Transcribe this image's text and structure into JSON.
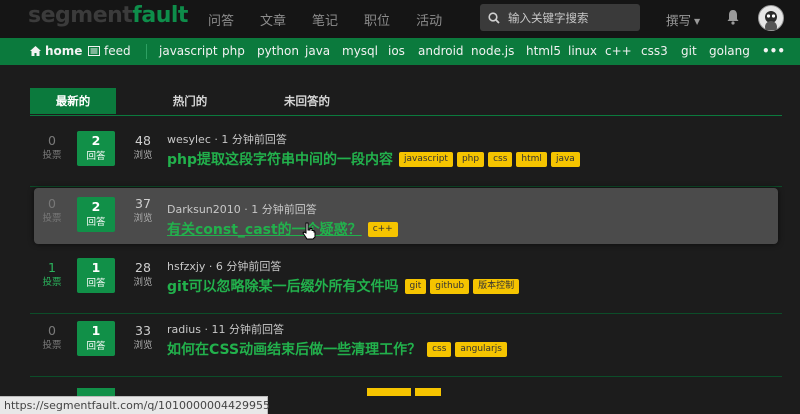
{
  "header": {
    "logo_part1": "segment",
    "logo_part2": "fault",
    "nav": [
      "问答",
      "文章",
      "笔记",
      "职位",
      "活动"
    ],
    "search_placeholder": "输入关键字搜索",
    "write_label": "撰写"
  },
  "subnav": {
    "home": "home",
    "feed": "feed",
    "tags": [
      "javascript",
      "php",
      "python",
      "java",
      "mysql",
      "ios",
      "android",
      "node.js",
      "html5",
      "linux",
      "c++",
      "css3",
      "git",
      "golang"
    ],
    "more": "•••"
  },
  "tabs": [
    "最新的",
    "热门的",
    "未回答的"
  ],
  "questions": [
    {
      "votes": "0",
      "votes_label": "投票",
      "answers": "2",
      "answers_label": "回答",
      "views": "48",
      "views_label": "浏览",
      "meta": "wesylec · 1 分钟前回答",
      "title": "php提取这段字符串中间的一段内容",
      "tags": [
        "javascript",
        "php",
        "css",
        "html",
        "java"
      ]
    },
    {
      "votes": "0",
      "votes_label": "投票",
      "answers": "2",
      "answers_label": "回答",
      "views": "37",
      "views_label": "浏览",
      "meta": "Darksun2010 · 1 分钟前回答",
      "title": "有关const_cast的一个疑惑？",
      "tags": [
        "c++"
      ]
    },
    {
      "votes": "1",
      "votes_label": "投票",
      "answers": "1",
      "answers_label": "回答",
      "views": "28",
      "views_label": "浏览",
      "meta": "hsfzxjy · 6 分钟前回答",
      "title": "git可以忽略除某一后缀外所有文件吗",
      "tags": [
        "git",
        "github",
        "版本控制"
      ]
    },
    {
      "votes": "0",
      "votes_label": "投票",
      "answers": "1",
      "answers_label": "回答",
      "views": "33",
      "views_label": "浏览",
      "meta": "radius · 11 分钟前回答",
      "title": "如何在CSS动画结束后做一些清理工作？",
      "tags": [
        "css",
        "angularjs"
      ]
    }
  ],
  "statusbar": "https://segmentfault.com/q/1010000004429955",
  "colors": {
    "accent": "#0b7a3d",
    "title_green": "#22b14c",
    "tag_yellow": "#f5c400"
  }
}
